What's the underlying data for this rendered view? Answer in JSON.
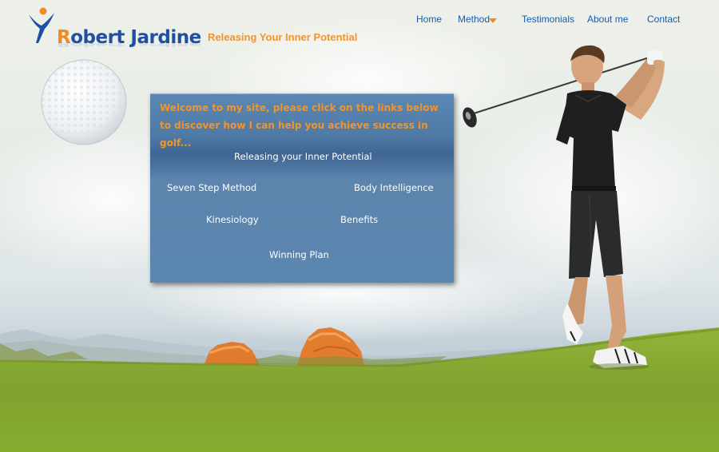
{
  "header": {
    "logo_first": "R",
    "logo_rest": "obert Jardine",
    "tagline": "Releasing Your Inner Potential"
  },
  "nav": {
    "items": [
      {
        "label": "Home"
      },
      {
        "label": "Method"
      },
      {
        "label": "Testimonials"
      },
      {
        "label": "About me"
      },
      {
        "label": "Contact"
      }
    ]
  },
  "panel": {
    "intro": "Welcome to my site, please click on the links below to discover how I can help you achieve success in golf...",
    "links": {
      "inner_potential": "Releasing your Inner Potential",
      "seven_step": "Seven Step Method",
      "body_intelligence": "Body Intelligence",
      "kinesiology": "Kinesiology",
      "benefits": "Benefits",
      "winning_plan": "Winning Plan"
    }
  },
  "colors": {
    "brand_blue": "#1f4fa0",
    "brand_orange": "#f08a22",
    "nav_blue": "#1a5aa8",
    "panel_blue": "#5b86b1",
    "grass_green": "#7fa830"
  },
  "icons": {
    "logo": "person-raised-arms-icon",
    "dropdown": "caret-down-icon"
  }
}
